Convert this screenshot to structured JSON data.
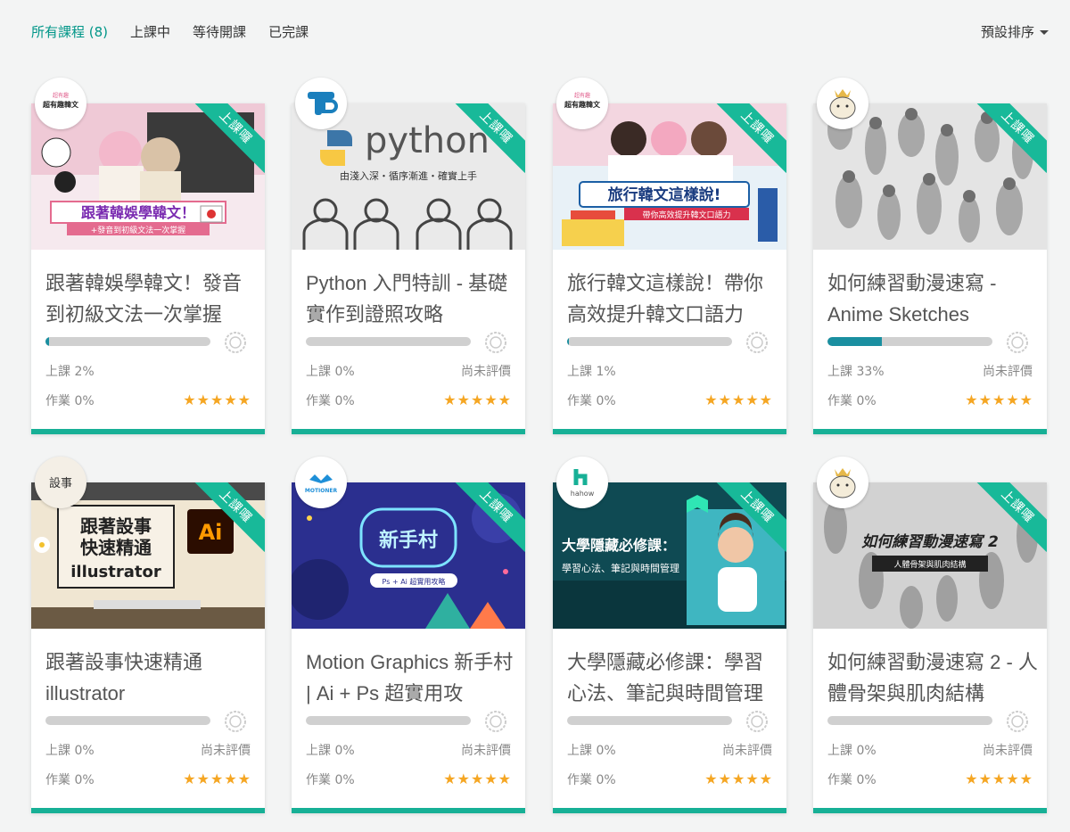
{
  "filters": {
    "tabs": [
      {
        "label": "所有課程 (8)",
        "active": true
      },
      {
        "label": "上課中",
        "active": false
      },
      {
        "label": "等待開課",
        "active": false
      },
      {
        "label": "已完課",
        "active": false
      }
    ],
    "sort_label": "預設排序"
  },
  "colors": {
    "accent": "#009688",
    "badge": "#18b999",
    "progress": "#1a8fa0",
    "star": "#f5a623"
  },
  "badge_label": "上課囉",
  "courses": [
    {
      "title": "跟著韓娛學韓文！發音到初級文法一次掌握",
      "thumb_text": "跟著韓娛學韓文！",
      "thumb_sub": "+發音到初級文法一次掌握",
      "logo_text": "超有趣韓文",
      "progress": 0.02,
      "class_label": "上課 2%",
      "rating_label": "",
      "homework_label": "作業 0%",
      "stars": 5
    },
    {
      "title": "Python 入門特訓 - 基礎實作到證照攻略",
      "thumb_text": "python",
      "thumb_sub": "由淺入深・循序漸進・確實上手",
      "logo_text": "",
      "progress": 0,
      "class_label": "上課 0%",
      "rating_label": "尚未評價",
      "homework_label": "作業 0%",
      "stars": 5
    },
    {
      "title": "旅行韓文這樣說！帶你高效提升韓文口語力",
      "thumb_text": "旅行韓文這樣說!",
      "thumb_sub": "帶你高效提升韓文口語力",
      "logo_text": "超有趣韓文",
      "progress": 0.01,
      "class_label": "上課 1%",
      "rating_label": "",
      "homework_label": "作業 0%",
      "stars": 5
    },
    {
      "title": "如何練習動漫速寫 - Anime Sketches",
      "thumb_text": "",
      "thumb_sub": "",
      "logo_text": "",
      "progress": 0.33,
      "class_label": "上課 33%",
      "rating_label": "尚未評價",
      "homework_label": "作業 0%",
      "stars": 5
    },
    {
      "title": "跟著設事快速精通 illustrator",
      "thumb_text": "跟著設事快速精通",
      "thumb_sub": "illustrator",
      "logo_text": "設事",
      "progress": 0,
      "class_label": "上課 0%",
      "rating_label": "尚未評價",
      "homework_label": "作業 0%",
      "stars": 5
    },
    {
      "title": "Motion Graphics 新手村 | Ai + Ps 超實用攻",
      "thumb_text": "新手村",
      "thumb_sub": "Ps + Ai 超實用攻略",
      "logo_text": "MOTIONER",
      "progress": 0,
      "class_label": "上課 0%",
      "rating_label": "尚未評價",
      "homework_label": "作業 0%",
      "stars": 5
    },
    {
      "title": "大學隱藏必修課：學習心法、筆記與時間管理",
      "thumb_text": "大學隱藏必修課：",
      "thumb_sub": "學習心法、筆記與時間管理",
      "logo_text": "hahow",
      "progress": 0,
      "class_label": "上課 0%",
      "rating_label": "尚未評價",
      "homework_label": "作業 0%",
      "stars": 5
    },
    {
      "title": "如何練習動漫速寫 2 - 人體骨架與肌肉結構",
      "thumb_text": "如何練習動漫速寫 2",
      "thumb_sub": "人體骨架與肌肉結構",
      "logo_text": "",
      "progress": 0,
      "class_label": "上課 0%",
      "rating_label": "尚未評價",
      "homework_label": "作業 0%",
      "stars": 5
    }
  ]
}
